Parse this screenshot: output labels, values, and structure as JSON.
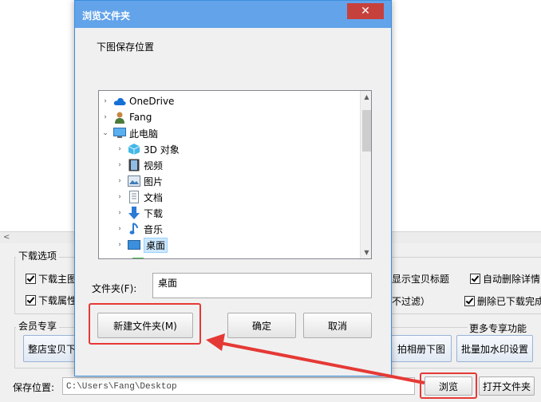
{
  "dialog": {
    "title": "浏览文件夹",
    "close_glyph": "✕",
    "instruction": "下图保存位置",
    "tree": [
      {
        "label": "OneDrive",
        "level": 0,
        "expander": "›",
        "icon": "cloud-icon"
      },
      {
        "label": "Fang",
        "level": 0,
        "expander": "›",
        "icon": "user-icon"
      },
      {
        "label": "此电脑",
        "level": 0,
        "expander": "⌄",
        "icon": "computer-icon"
      },
      {
        "label": "3D 对象",
        "level": 1,
        "expander": "›",
        "icon": "cube-icon"
      },
      {
        "label": "视频",
        "level": 1,
        "expander": "›",
        "icon": "video-icon"
      },
      {
        "label": "图片",
        "level": 1,
        "expander": "›",
        "icon": "picture-icon"
      },
      {
        "label": "文档",
        "level": 1,
        "expander": "›",
        "icon": "document-icon"
      },
      {
        "label": "下载",
        "level": 1,
        "expander": "›",
        "icon": "download-icon"
      },
      {
        "label": "音乐",
        "level": 1,
        "expander": "›",
        "icon": "music-icon"
      },
      {
        "label": "桌面",
        "level": 1,
        "expander": "›",
        "icon": "desktop-icon",
        "selected": true
      }
    ],
    "folder_label": "文件夹(F):",
    "folder_value": "桌面",
    "new_folder_label": "新建文件夹(M)",
    "ok_label": "确定",
    "cancel_label": "取消"
  },
  "app": {
    "download_options_title": "下载选项",
    "checkboxes_left": [
      "下载主图",
      "下载属性"
    ],
    "checkboxes_right": [
      "显示宝贝标题",
      "自动删除详情",
      "不过滤）",
      "删除已下载完成"
    ],
    "member_title": "会员专享",
    "more_features": "更多专享功能>>>",
    "member_buttons": [
      "整店宝贝下",
      "拍相册下图",
      "批量加水印设置"
    ],
    "save_location_label": "保存位置:",
    "save_path": "C:\\Users\\Fang\\Desktop",
    "browse_label": "浏览",
    "open_folder_label": "打开文件夹"
  },
  "colors": {
    "titlebar": "#62a3ea",
    "close": "#c7413c",
    "annotation": "#e53935",
    "selection": "#cce8ff"
  }
}
